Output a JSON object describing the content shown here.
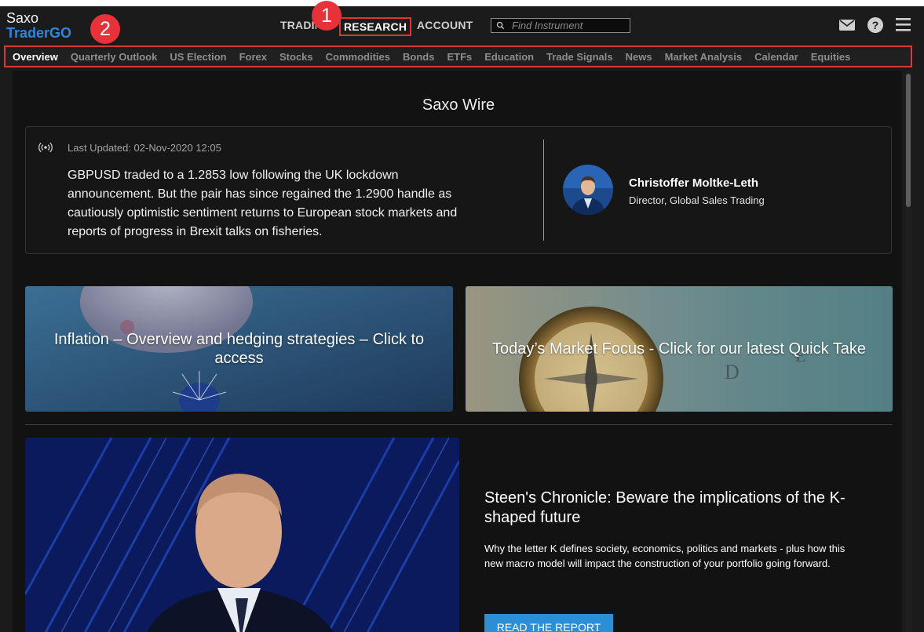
{
  "brand": {
    "line1": "Saxo",
    "line2": "TraderGO"
  },
  "topnav": {
    "trading": "TRADING",
    "research": "RESEARCH",
    "account": "ACCOUNT"
  },
  "search": {
    "placeholder": "Find Instrument"
  },
  "icons": {
    "mail": "mail-icon",
    "help": "help-icon",
    "menu": "hamburger-menu-icon",
    "search": "search-icon",
    "broadcast": "broadcast-icon"
  },
  "badges": {
    "one": "1",
    "two": "2"
  },
  "subnav": [
    {
      "label": "Overview",
      "active": true
    },
    {
      "label": "Quarterly Outlook"
    },
    {
      "label": "US Election"
    },
    {
      "label": "Forex"
    },
    {
      "label": "Stocks"
    },
    {
      "label": "Commodities"
    },
    {
      "label": "Bonds"
    },
    {
      "label": "ETFs"
    },
    {
      "label": "Education"
    },
    {
      "label": "Trade Signals"
    },
    {
      "label": "News"
    },
    {
      "label": "Market Analysis"
    },
    {
      "label": "Calendar"
    },
    {
      "label": "Equities"
    }
  ],
  "wire": {
    "title": "Saxo Wire",
    "updated": "Last Updated: 02-Nov-2020 12:05",
    "body": "GBPUSD traded to a 1.2853 low following the UK lockdown announcement. But the pair has since regained the 1.2900 handle as cautiously optimistic sentiment returns to European stock markets and reports of progress in Brexit talks on fisheries.",
    "author_name": "Christoffer Moltke-Leth",
    "author_role": "Director, Global Sales Trading"
  },
  "cards": {
    "inflation": "Inflation – Overview and hedging strategies – Click to access",
    "focus": "Today’s Market Focus - Click for our latest Quick Take"
  },
  "chronicle": {
    "title": "Steen's Chronicle: Beware the implications of the K-shaped future",
    "description": "Why the letter K defines society, economics, politics and markets - plus how this new macro model will impact the construction of your portfolio going forward.",
    "button": "READ THE REPORT"
  },
  "colors": {
    "accent": "#2c8fd6",
    "highlight": "#e5323a",
    "brand_blue": "#2e86de",
    "background": "#121212"
  }
}
